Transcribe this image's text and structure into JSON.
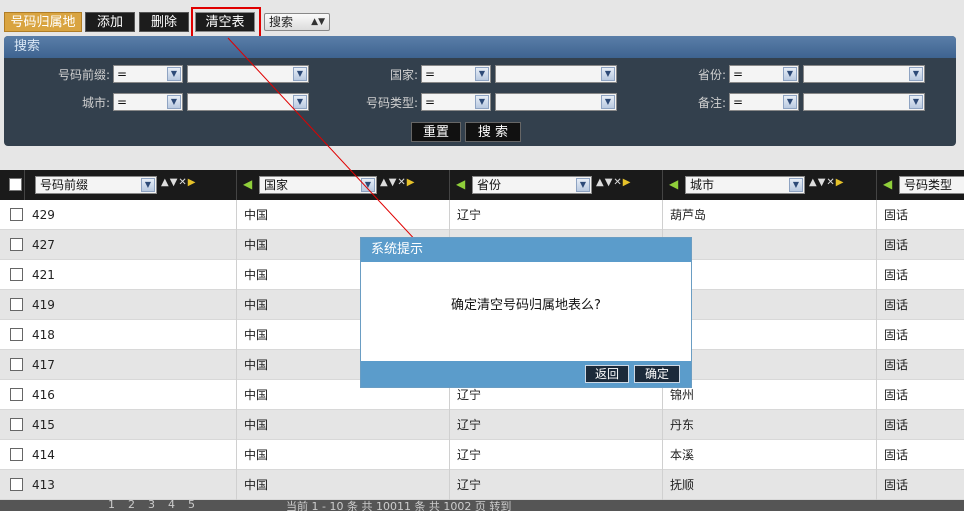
{
  "toolbar": {
    "module_label": "号码归属地",
    "add_label": "添加",
    "delete_label": "删除",
    "clear_label": "清空表",
    "search_select": "搜索"
  },
  "search": {
    "title": "搜索",
    "fields": [
      {
        "label": "号码前缀:",
        "op": "="
      },
      {
        "label": "国家:",
        "op": "="
      },
      {
        "label": "省份:",
        "op": "="
      },
      {
        "label": "城市:",
        "op": "="
      },
      {
        "label": "号码类型:",
        "op": "="
      },
      {
        "label": "备注:",
        "op": "="
      }
    ],
    "reset_label": "重置",
    "search_label": "搜 索"
  },
  "grid": {
    "columns": [
      "号码前缀",
      "国家",
      "省份",
      "城市",
      "号码类型"
    ],
    "rows": [
      [
        "429",
        "中国",
        "辽宁",
        "葫芦岛",
        "固话"
      ],
      [
        "427",
        "中国",
        "",
        "",
        "固话"
      ],
      [
        "421",
        "中国",
        "",
        "",
        "固话"
      ],
      [
        "419",
        "中国",
        "",
        "",
        "固话"
      ],
      [
        "418",
        "中国",
        "",
        "",
        "固话"
      ],
      [
        "417",
        "中国",
        "",
        "",
        "固话"
      ],
      [
        "416",
        "中国",
        "辽宁",
        "锦州",
        "固话"
      ],
      [
        "415",
        "中国",
        "辽宁",
        "丹东",
        "固话"
      ],
      [
        "414",
        "中国",
        "辽宁",
        "本溪",
        "固话"
      ],
      [
        "413",
        "中国",
        "辽宁",
        "抚顺",
        "固话"
      ]
    ]
  },
  "pager": {
    "pages": [
      "1",
      "2",
      "3",
      "4",
      "5"
    ],
    "summary": "当前 1 - 10 条 共 10011 条 共 1002 页 转到"
  },
  "dialog": {
    "title": "系统提示",
    "message": "确定清空号码归属地表么?",
    "back_label": "返回",
    "ok_label": "确定"
  },
  "colors": {
    "highlight": "#e00000",
    "dialog_bar": "#5b9ccb",
    "search_panel": "#33404d"
  }
}
